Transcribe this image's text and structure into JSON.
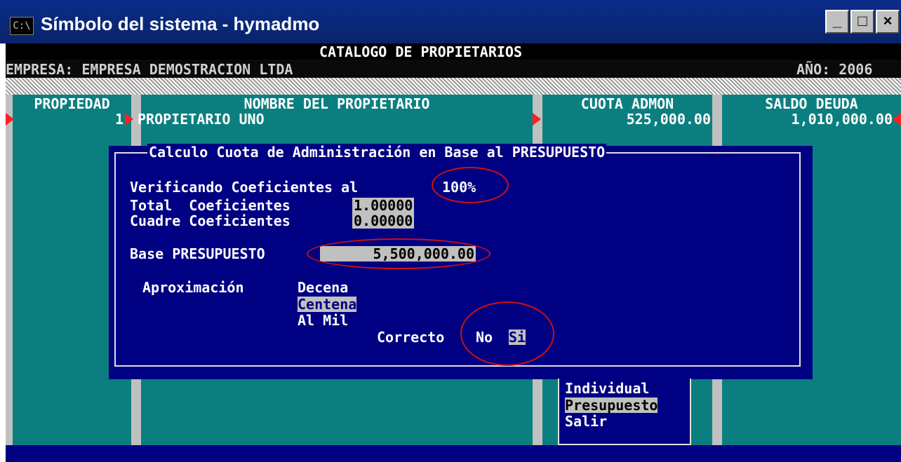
{
  "window": {
    "icon_text": "C:\\",
    "title": "Símbolo del sistema - hymadmo",
    "controls": {
      "minimize": "_",
      "maximize": "□",
      "close": "×"
    }
  },
  "header": {
    "title": "CATALOGO DE PROPIETARIOS",
    "empresa": "EMPRESA: EMPRESA DEMOSTRACION LTDA",
    "anio": "AÑO: 2006"
  },
  "table": {
    "columns": [
      "PROPIEDAD",
      "NOMBRE DEL PROPIETARIO",
      "CUOTA ADMON",
      "SALDO DEUDA"
    ],
    "rows": [
      {
        "propiedad": "1",
        "nombre": "PROPIETARIO UNO",
        "cuota": "525,000.00",
        "saldo": "1,010,000.00"
      }
    ]
  },
  "dialog": {
    "title": "Calculo Cuota de Administración en Base al PRESUPUESTO",
    "verificando_label": "Verificando Coeficientes al",
    "verificando_value": "100%",
    "total_label": "Total  Coeficientes",
    "total_value": "1.00000",
    "cuadre_label": "Cuadre Coeficientes",
    "cuadre_value": "0.00000",
    "base_label": "Base PRESUPUESTO",
    "base_value": "5,500,000.00",
    "aprox_label": "Aproximación",
    "aprox_options": [
      "Decena",
      "Centena",
      "Al Mil"
    ],
    "aprox_selected": "Centena",
    "correcto_label": "Correcto",
    "correcto_no": "No",
    "correcto_si": "Si",
    "correcto_selected": "Si"
  },
  "menu": {
    "items": [
      "Individual",
      "Presupuesto",
      "Salir"
    ],
    "selected": "Presupuesto"
  },
  "colors": {
    "console_bg": "#000000",
    "table_bg": "#0b7f80",
    "dialog_bg": "#000082",
    "highlight": "#c0c0c0",
    "annotation": "#d01010"
  }
}
